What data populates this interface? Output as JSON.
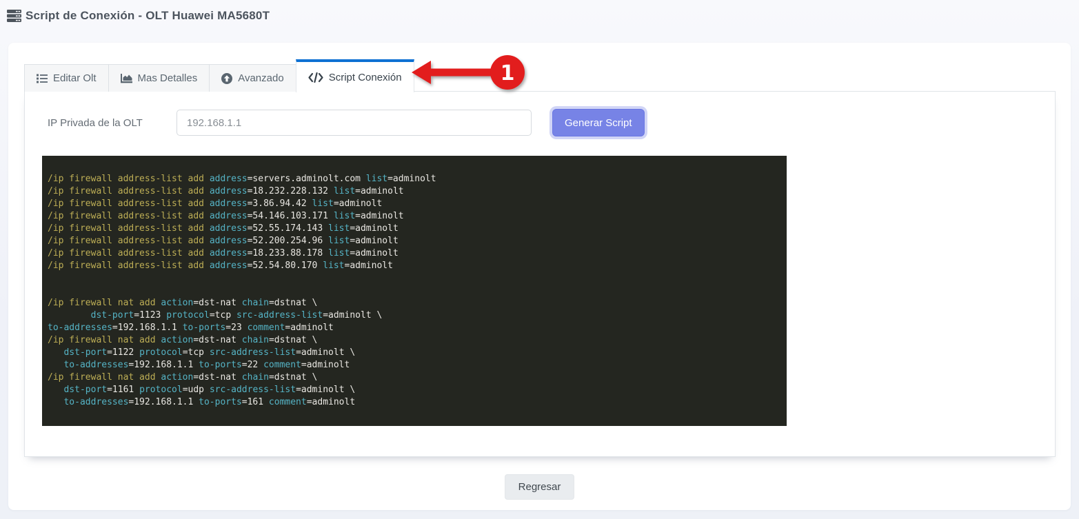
{
  "header": {
    "title": "Script de Conexión - OLT Huawei MA5680T",
    "icon": "server-icon"
  },
  "tabs": [
    {
      "label": "Editar Olt",
      "icon": "list-icon",
      "active": false
    },
    {
      "label": "Mas Detalles",
      "icon": "chart-area-icon",
      "active": false
    },
    {
      "label": "Avanzado",
      "icon": "arrow-circle-up-icon",
      "active": false
    },
    {
      "label": "Script Conexión",
      "icon": "code-icon",
      "active": true
    }
  ],
  "annotation": {
    "step_number": "1",
    "color": "#e21d1d",
    "shape": "arrow-pointing-left-at-active-tab"
  },
  "form": {
    "ip_label": "IP Privada de la OLT",
    "ip_value": "192.168.1.1",
    "generate_button": "Generar Script"
  },
  "script": {
    "colors": {
      "background": "#242620",
      "command": "#bdae55",
      "key": "#55b4c6",
      "value": "#e9e7e2"
    },
    "lines": [
      [
        [
          "cmd",
          "/ip firewall address-list add "
        ],
        [
          "key",
          "address"
        ],
        [
          "val",
          "=servers.adminolt.com "
        ],
        [
          "key",
          "list"
        ],
        [
          "val",
          "=adminolt"
        ]
      ],
      [
        [
          "cmd",
          "/ip firewall address-list add "
        ],
        [
          "key",
          "address"
        ],
        [
          "val",
          "=18.232.228.132 "
        ],
        [
          "key",
          "list"
        ],
        [
          "val",
          "=adminolt"
        ]
      ],
      [
        [
          "cmd",
          "/ip firewall address-list add "
        ],
        [
          "key",
          "address"
        ],
        [
          "val",
          "=3.86.94.42 "
        ],
        [
          "key",
          "list"
        ],
        [
          "val",
          "=adminolt"
        ]
      ],
      [
        [
          "cmd",
          "/ip firewall address-list add "
        ],
        [
          "key",
          "address"
        ],
        [
          "val",
          "=54.146.103.171 "
        ],
        [
          "key",
          "list"
        ],
        [
          "val",
          "=adminolt"
        ]
      ],
      [
        [
          "cmd",
          "/ip firewall address-list add "
        ],
        [
          "key",
          "address"
        ],
        [
          "val",
          "=52.55.174.143 "
        ],
        [
          "key",
          "list"
        ],
        [
          "val",
          "=adminolt"
        ]
      ],
      [
        [
          "cmd",
          "/ip firewall address-list add "
        ],
        [
          "key",
          "address"
        ],
        [
          "val",
          "=52.200.254.96 "
        ],
        [
          "key",
          "list"
        ],
        [
          "val",
          "=adminolt"
        ]
      ],
      [
        [
          "cmd",
          "/ip firewall address-list add "
        ],
        [
          "key",
          "address"
        ],
        [
          "val",
          "=18.233.88.178 "
        ],
        [
          "key",
          "list"
        ],
        [
          "val",
          "=adminolt"
        ]
      ],
      [
        [
          "cmd",
          "/ip firewall address-list add "
        ],
        [
          "key",
          "address"
        ],
        [
          "val",
          "=52.54.80.170 "
        ],
        [
          "key",
          "list"
        ],
        [
          "val",
          "=adminolt"
        ]
      ],
      [],
      [],
      [
        [
          "cmd",
          "/ip firewall nat add "
        ],
        [
          "key",
          "action"
        ],
        [
          "val",
          "=dst-nat "
        ],
        [
          "key",
          "chain"
        ],
        [
          "val",
          "=dstnat \\"
        ]
      ],
      [
        [
          "val",
          "        "
        ],
        [
          "key",
          "dst-port"
        ],
        [
          "val",
          "=1123 "
        ],
        [
          "key",
          "protocol"
        ],
        [
          "val",
          "=tcp "
        ],
        [
          "key",
          "src-address-list"
        ],
        [
          "val",
          "=adminolt \\"
        ]
      ],
      [
        [
          "key",
          "to-addresses"
        ],
        [
          "val",
          "=192.168.1.1 "
        ],
        [
          "key",
          "to-ports"
        ],
        [
          "val",
          "=23 "
        ],
        [
          "key",
          "comment"
        ],
        [
          "val",
          "=adminolt"
        ]
      ],
      [
        [
          "cmd",
          "/ip firewall nat add "
        ],
        [
          "key",
          "action"
        ],
        [
          "val",
          "=dst-nat "
        ],
        [
          "key",
          "chain"
        ],
        [
          "val",
          "=dstnat \\"
        ]
      ],
      [
        [
          "val",
          "   "
        ],
        [
          "key",
          "dst-port"
        ],
        [
          "val",
          "=1122 "
        ],
        [
          "key",
          "protocol"
        ],
        [
          "val",
          "=tcp "
        ],
        [
          "key",
          "src-address-list"
        ],
        [
          "val",
          "=adminolt \\"
        ]
      ],
      [
        [
          "val",
          "   "
        ],
        [
          "key",
          "to-addresses"
        ],
        [
          "val",
          "=192.168.1.1 "
        ],
        [
          "key",
          "to-ports"
        ],
        [
          "val",
          "=22 "
        ],
        [
          "key",
          "comment"
        ],
        [
          "val",
          "=adminolt"
        ]
      ],
      [
        [
          "cmd",
          "/ip firewall nat add "
        ],
        [
          "key",
          "action"
        ],
        [
          "val",
          "=dst-nat "
        ],
        [
          "key",
          "chain"
        ],
        [
          "val",
          "=dstnat \\"
        ]
      ],
      [
        [
          "val",
          "   "
        ],
        [
          "key",
          "dst-port"
        ],
        [
          "val",
          "=1161 "
        ],
        [
          "key",
          "protocol"
        ],
        [
          "val",
          "=udp "
        ],
        [
          "key",
          "src-address-list"
        ],
        [
          "val",
          "=adminolt \\"
        ]
      ],
      [
        [
          "val",
          "   "
        ],
        [
          "key",
          "to-addresses"
        ],
        [
          "val",
          "=192.168.1.1 "
        ],
        [
          "key",
          "to-ports"
        ],
        [
          "val",
          "=161 "
        ],
        [
          "key",
          "comment"
        ],
        [
          "val",
          "=adminolt"
        ]
      ]
    ]
  },
  "footer": {
    "back_button": "Regresar"
  }
}
